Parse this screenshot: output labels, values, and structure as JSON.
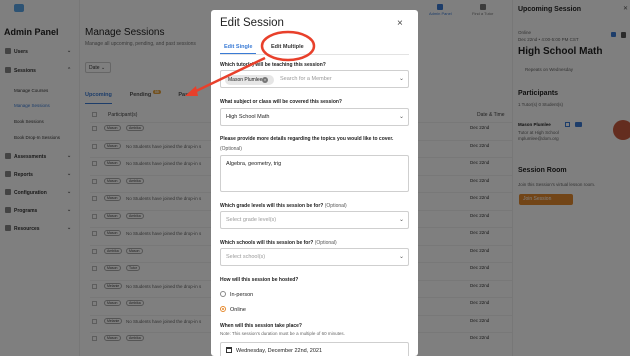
{
  "sidebar": {
    "title": "Admin Panel",
    "items": [
      {
        "label": "Users"
      },
      {
        "label": "Sessions"
      },
      {
        "label": "Assessments"
      },
      {
        "label": "Reports"
      },
      {
        "label": "Configuration"
      },
      {
        "label": "Programs"
      },
      {
        "label": "Resources"
      }
    ],
    "subitems": [
      {
        "label": "Manage Courses"
      },
      {
        "label": "Manage Sessions"
      },
      {
        "label": "Book Sessions"
      },
      {
        "label": "Book Drop-In Sessions"
      }
    ]
  },
  "topbar": {
    "items": [
      {
        "label": "Admin Panel"
      },
      {
        "label": "Find a Tutor"
      }
    ]
  },
  "main": {
    "title": "Manage Sessions",
    "subtitle": "Manage all upcoming, pending, and past sessions",
    "date_filter": "Date",
    "tabs": [
      {
        "label": "Upcoming"
      },
      {
        "label": "Pending",
        "badge": "55"
      },
      {
        "label": "Past"
      }
    ],
    "table": {
      "header_participants": "Participant(s)",
      "header_date": "Date & Time",
      "rows": [
        {
          "pills": [
            "Mason",
            "Ambika"
          ],
          "msg": "",
          "date": "Dec 22nd"
        },
        {
          "pills": [
            "Mason"
          ],
          "msg": "No Students have joined the drop-in s",
          "date": "Dec 22nd"
        },
        {
          "pills": [
            "Mason"
          ],
          "msg": "No Students have joined the drop-in s",
          "date": "Dec 22nd"
        },
        {
          "pills": [
            "Mason",
            "Ambika"
          ],
          "msg": "",
          "date": "Dec 22nd"
        },
        {
          "pills": [
            "Mason"
          ],
          "msg": "No Students have joined the drop-in s",
          "date": "Dec 22nd"
        },
        {
          "pills": [
            "Mason",
            "Ambika"
          ],
          "msg": "",
          "date": "Dec 22nd"
        },
        {
          "pills": [
            "Mason"
          ],
          "msg": "No Students have joined the drop-in s",
          "date": "Dec 22nd"
        },
        {
          "pills": [
            "Ambika",
            "Mason"
          ],
          "msg": "",
          "date": "Dec 22nd"
        },
        {
          "pills": [
            "Mason",
            "Tutor"
          ],
          "msg": "",
          "date": "Dec 22nd"
        },
        {
          "pills": [
            "Melanie"
          ],
          "msg": "No Students have joined the drop-in s",
          "date": "Dec 22nd"
        },
        {
          "pills": [
            "Mason",
            "Ambika"
          ],
          "msg": "",
          "date": "Dec 22nd"
        },
        {
          "pills": [
            "Melanie"
          ],
          "msg": "No Students have joined the drop-in s",
          "date": "Dec 22nd"
        },
        {
          "pills": [
            "Mason",
            "Ambika"
          ],
          "msg": "",
          "date": "Dec 22nd"
        }
      ]
    }
  },
  "right_panel": {
    "title": "Upcoming Session",
    "status": "Online",
    "datetime": "Dec 22nd • 4:00-5:00 PM CST",
    "session_title": "High School Math",
    "repeat": "Repeats on Wednesday",
    "participants_title": "Participants",
    "participants_count": "1 Tutor(s) 0 Student(s)",
    "tutor_name": "Mason Plumlee",
    "tutor_role": "Tutor at High School",
    "tutor_email": "mplumlee@dom.org",
    "room_title": "Session Room",
    "room_desc": "Join this Session's virtual lesson room.",
    "join_button": "Join Session"
  },
  "modal": {
    "title": "Edit Session",
    "tab_single": "Edit Single",
    "tab_multiple": "Edit Multiple",
    "q_tutor": "Which tutor(s) will be teaching this session?",
    "tutor_chip": "Mason Plumlee",
    "tutor_search_placeholder": "Search for a Member",
    "q_subject": "What subject or class will be covered this session?",
    "subject_value": "High School Math",
    "q_details": "Please provide more details regarding the topics you would like to cover.",
    "details_optional": "(Optional)",
    "details_value": "Algebra, geometry, trig",
    "q_grades": "Which grade levels will this session be for?",
    "grades_optional": "(Optional)",
    "grades_placeholder": "Select grade level(s)",
    "q_schools": "Which schools will this session be for?",
    "schools_optional": "(Optional)",
    "schools_placeholder": "Select school(s)",
    "q_hosted": "How will this session be hosted?",
    "opt_in_person": "In-person",
    "opt_online": "Online",
    "selected_hosting": "Online",
    "q_when": "When will this session take place?",
    "when_note": "Note: This session's duration must be a multiple of 60 minutes.",
    "date_value": "Wednesday, December 22nd, 2021"
  },
  "colors": {
    "accent": "#3a7bd5",
    "join_button": "#e58a2e",
    "annotation_red": "#e8402b"
  }
}
